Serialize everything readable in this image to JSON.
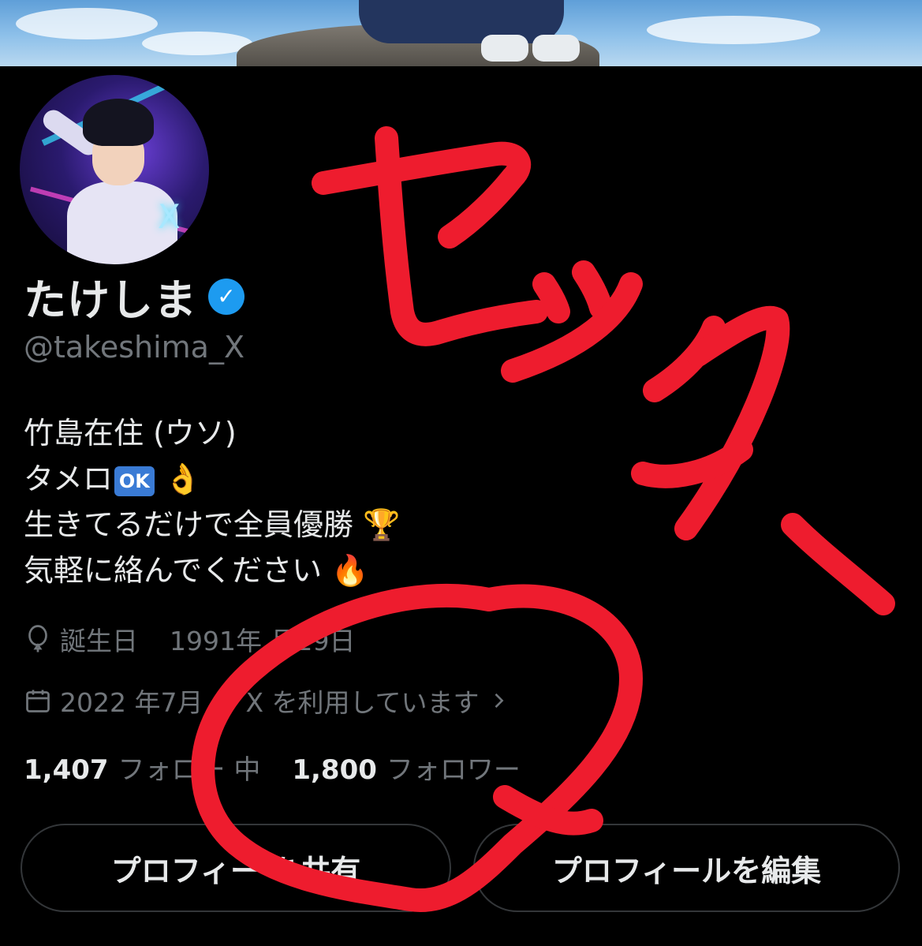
{
  "profile": {
    "display_name": "たけしま",
    "handle": "@takeshima_X",
    "verified": true,
    "bio": {
      "line1": "竹島在住 (ウソ)",
      "line2_text": "タメロ",
      "line2_badge": "OK",
      "line2_emoji": "👌",
      "line3_text": "生きてるだけで全員優勝",
      "line3_emoji": "🏆",
      "line4_text": "気軽に絡んでください",
      "line4_emoji": "🔥"
    },
    "birthday_label": "誕生日",
    "birthday_value": "1991年 月29日",
    "joined_text": "2022 年7月 ら X を利用しています",
    "following_count": "1,407",
    "following_label": "フォロー 中",
    "followers_count": "1,800",
    "followers_label": "フォロワー"
  },
  "buttons": {
    "share_label": "プロフィー を共有",
    "edit_label": "プロフィールを編集"
  },
  "colors": {
    "background": "#000000",
    "primary_text": "#e7e9ea",
    "secondary_text": "#71767b",
    "verified_blue": "#1d9bf0",
    "scribble_red": "#ee1c2e"
  },
  "icons": {
    "verified": "verified-badge-icon",
    "birthday": "balloon-icon",
    "joined": "calendar-icon",
    "chevron": "chevron-right-icon"
  }
}
